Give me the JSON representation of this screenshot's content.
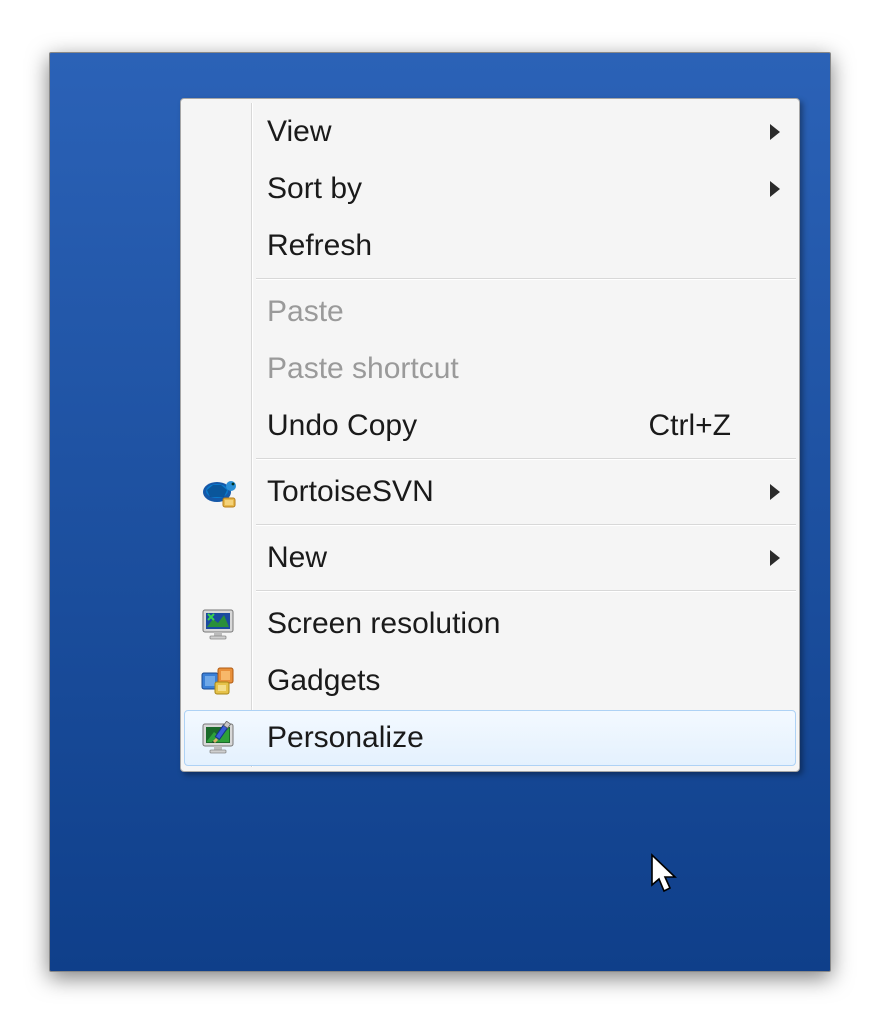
{
  "menu": {
    "items": [
      {
        "label": "View",
        "icon": null,
        "submenu": true,
        "disabled": false,
        "shortcut": null,
        "hovered": false
      },
      {
        "label": "Sort by",
        "icon": null,
        "submenu": true,
        "disabled": false,
        "shortcut": null,
        "hovered": false
      },
      {
        "label": "Refresh",
        "icon": null,
        "submenu": false,
        "disabled": false,
        "shortcut": null,
        "hovered": false
      },
      {
        "separator": true
      },
      {
        "label": "Paste",
        "icon": null,
        "submenu": false,
        "disabled": true,
        "shortcut": null,
        "hovered": false
      },
      {
        "label": "Paste shortcut",
        "icon": null,
        "submenu": false,
        "disabled": true,
        "shortcut": null,
        "hovered": false
      },
      {
        "label": "Undo Copy",
        "icon": null,
        "submenu": false,
        "disabled": false,
        "shortcut": "Ctrl+Z",
        "hovered": false
      },
      {
        "separator": true
      },
      {
        "label": "TortoiseSVN",
        "icon": "tortoise",
        "submenu": true,
        "disabled": false,
        "shortcut": null,
        "hovered": false
      },
      {
        "separator": true
      },
      {
        "label": "New",
        "icon": null,
        "submenu": true,
        "disabled": false,
        "shortcut": null,
        "hovered": false
      },
      {
        "separator": true
      },
      {
        "label": "Screen resolution",
        "icon": "monitor",
        "submenu": false,
        "disabled": false,
        "shortcut": null,
        "hovered": false
      },
      {
        "label": "Gadgets",
        "icon": "gadgets",
        "submenu": false,
        "disabled": false,
        "shortcut": null,
        "hovered": false
      },
      {
        "label": "Personalize",
        "icon": "personalize",
        "submenu": false,
        "disabled": false,
        "shortcut": null,
        "hovered": true
      }
    ]
  }
}
